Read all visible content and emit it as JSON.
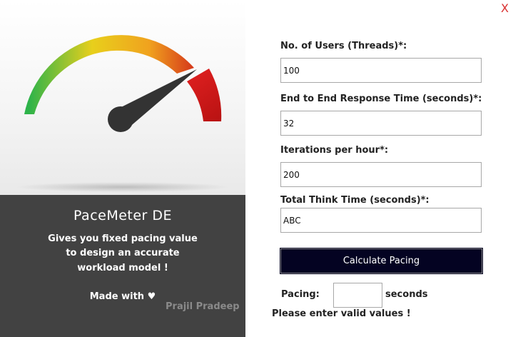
{
  "window": {
    "close_label": "X"
  },
  "brand": {
    "app_name": "PaceMeter DE",
    "tagline_lines": [
      "Gives you fixed pacing value",
      "to design an accurate",
      "workload model !"
    ],
    "made_with": "Made with ♥",
    "author": "Prajil Pradeep"
  },
  "gauge": {
    "icon": "speedometer-gauge",
    "colors": {
      "green": "#2db34a",
      "yellow": "#e8cf1c",
      "orange": "#f0a21e",
      "red": "#d01d1d",
      "needle": "#333333"
    }
  },
  "form": {
    "users": {
      "label": "No. of Users (Threads)*:",
      "value": "100"
    },
    "response_time": {
      "label": "End to End Response Time (seconds)*:",
      "value": "32"
    },
    "iterations": {
      "label": "Iterations per hour*:",
      "value": "200"
    },
    "think_time": {
      "label": "Total Think Time (seconds)*:",
      "value": "ABC"
    },
    "calculate_label": "Calculate Pacing"
  },
  "result": {
    "pacing_label": "Pacing:",
    "pacing_value": "",
    "unit": "seconds",
    "error": "Please enter valid values !"
  },
  "colors": {
    "button_bg": "#040322",
    "close": "#d93030",
    "info_bg": "#424242"
  }
}
